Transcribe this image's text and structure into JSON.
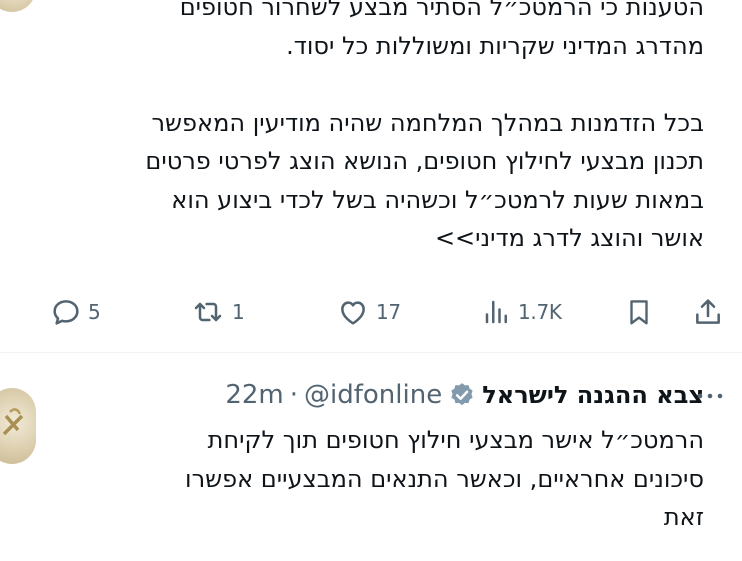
{
  "tweet1": {
    "text": "הטענות כי הרמטכ״ל הסתיר מבצע לשחרור חטופים\nמהדרג המדיני שקריות ומשוללות כל יסוד.\n\nבכל הזדמנות במהלך המלחמה שהיה מודיעין המאפשר\nתכנון מבצעי לחילוץ חטופים, הנושא הוצג לפרטי פרטים\nבמאות שעות לרמטכ״ל וכשהיה בשל לכדי ביצוע הוא\nאושר והוצג לדרג מדיני>>"
  },
  "actions": {
    "replies": "5",
    "reposts": "1",
    "likes": "17",
    "views": "1.7K"
  },
  "tweet2": {
    "display_name": "צבא ההגנה לישראל",
    "handle": "@idfonline",
    "separator": "·",
    "time": "22m",
    "text": "הרמטכ״ל אישר מבצעי חילוץ חטופים תוך לקיחת\nסיכונים אחראיים, וכאשר התנאים המבצעיים אפשרו\nזאת"
  },
  "colors": {
    "text": "#0f1419",
    "secondary": "#536471",
    "verified_badge": "#829aab"
  },
  "icons": [
    "reply-icon",
    "repost-icon",
    "like-icon",
    "views-icon",
    "bookmark-icon",
    "share-icon",
    "verified-badge-icon",
    "more-icon",
    "avatar-emblem"
  ]
}
